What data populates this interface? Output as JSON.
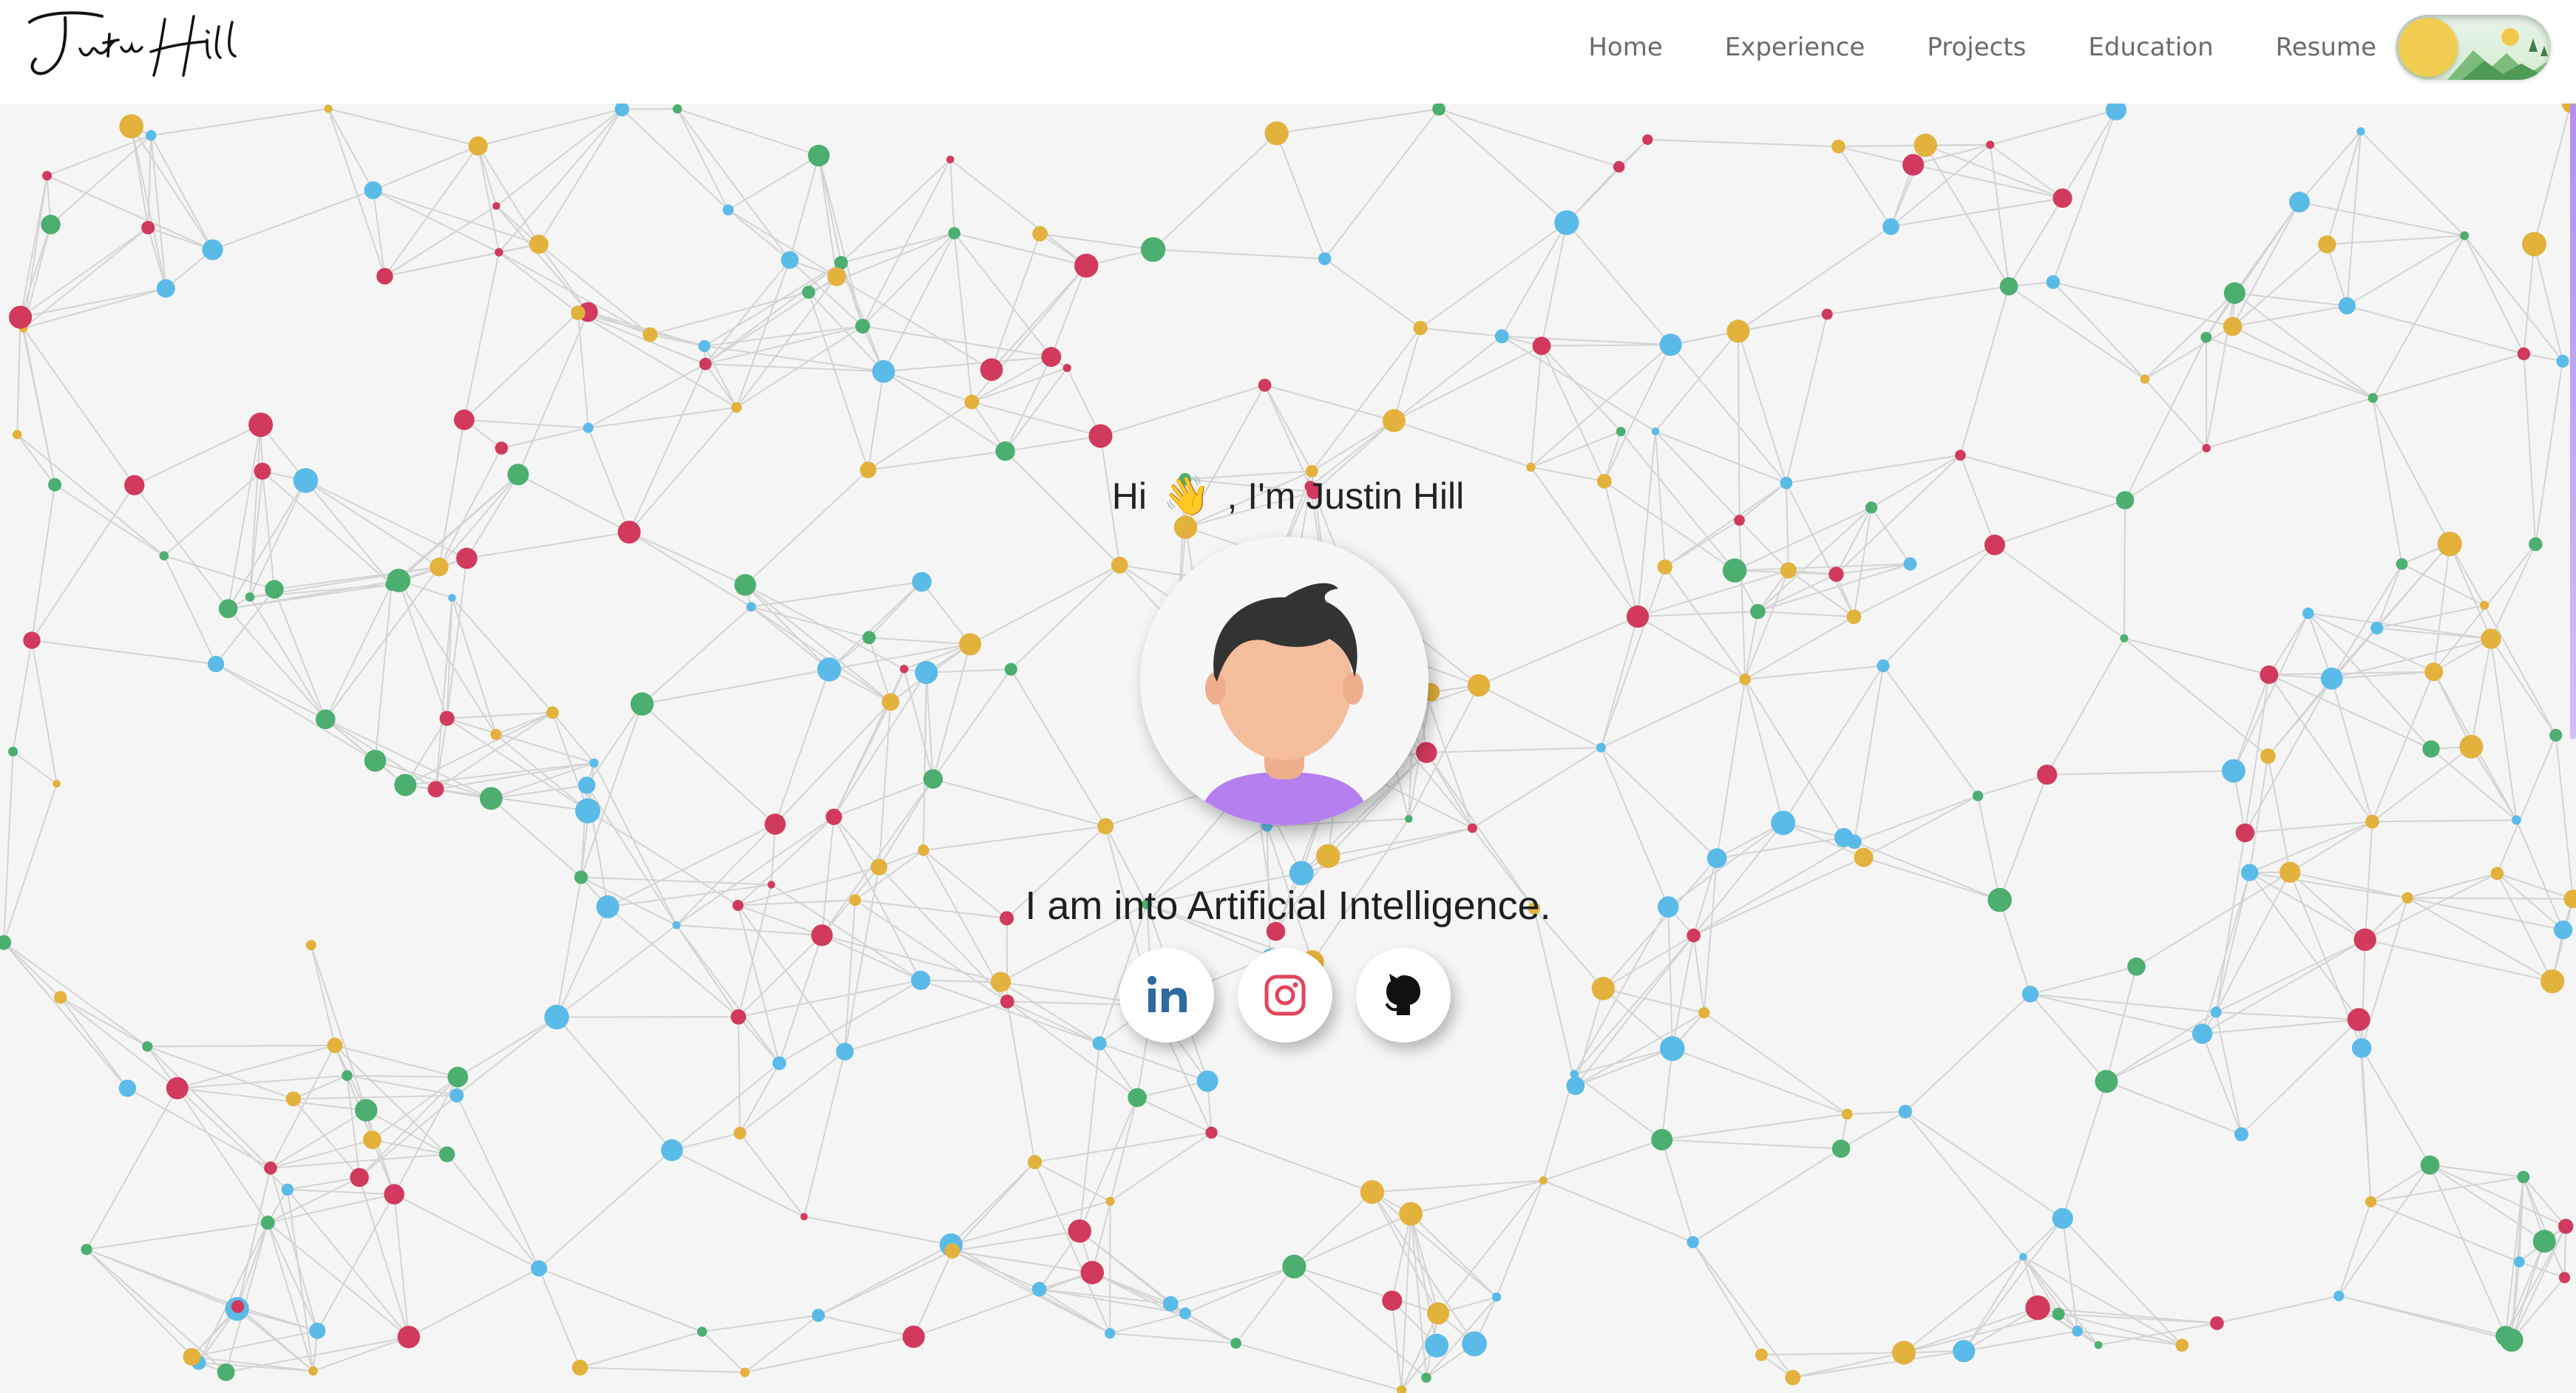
{
  "header": {
    "logo_text": "Justin Hill",
    "nav": [
      "Home",
      "Experience",
      "Projects",
      "Education",
      "Resume"
    ],
    "theme_toggle_icon": "sun-icon"
  },
  "hero": {
    "greeting_hi": "Hi",
    "greeting_wave": "👋",
    "greeting_im": ", I'm",
    "greeting_name": "Justin Hill",
    "avatar_icon": "avatar-icon",
    "tagline": "I am into Artificial Intelligence."
  },
  "socials": [
    {
      "name": "linkedin",
      "icon": "linkedin-icon"
    },
    {
      "name": "instagram",
      "icon": "instagram-icon"
    },
    {
      "name": "github",
      "icon": "github-icon"
    }
  ],
  "colors": {
    "node_red": "#d13a5c",
    "node_green": "#4caf70",
    "node_blue": "#5bbbe8",
    "node_yellow": "#e3b23c",
    "linkedin": "#2d6a9f",
    "instagram": "#e0465a",
    "avatar_shirt": "#b57ff0",
    "avatar_skin": "#f4bd9c",
    "avatar_hair": "#333333"
  }
}
